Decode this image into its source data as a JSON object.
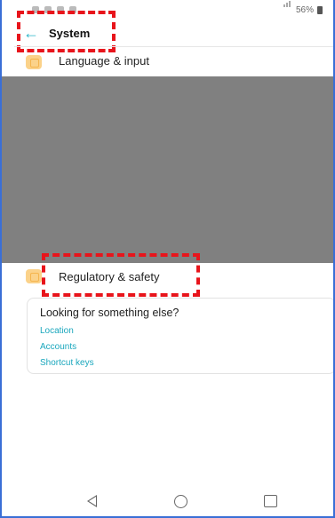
{
  "status_bar": {
    "battery_text": "56%",
    "icons": [
      "notification-icon",
      "notification-icon",
      "notification-icon",
      "notification-icon"
    ]
  },
  "header": {
    "back_icon": "back-arrow-icon",
    "title": "System"
  },
  "list": {
    "items": [
      {
        "label": "Language & input",
        "icon": "language-icon"
      },
      {
        "label": "Regulatory & safety",
        "icon": "regulatory-icon"
      }
    ]
  },
  "card": {
    "title": "Looking for something else?",
    "links": [
      "Location",
      "Accounts",
      "Shortcut keys"
    ]
  },
  "nav_bar": {
    "icons": [
      "back-triangle-icon",
      "home-circle-icon",
      "recents-square-icon"
    ]
  },
  "colors": {
    "accent": "#2bb5c9",
    "highlight": "#e8141b",
    "overlay": "#808080"
  }
}
